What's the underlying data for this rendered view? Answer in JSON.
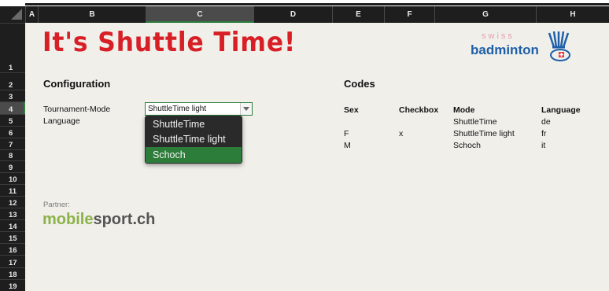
{
  "columns": [
    "A",
    "B",
    "C",
    "D",
    "E",
    "F",
    "G",
    "H"
  ],
  "selected_column": "C",
  "rows": [
    "1",
    "2",
    "3",
    "4",
    "5",
    "6",
    "7",
    "8",
    "9",
    "10",
    "11",
    "12",
    "13",
    "14",
    "15",
    "16",
    "17",
    "18",
    "19"
  ],
  "selected_row": "4",
  "title": "It's Shuttle Time!",
  "logo": {
    "top": "swiss",
    "main": "badminton"
  },
  "configuration": {
    "heading": "Configuration",
    "tournament_mode_label": "Tournament-Mode",
    "language_label": "Language",
    "dropdown": {
      "value": "ShuttleTime light",
      "options": [
        "ShuttleTime",
        "ShuttleTime light",
        "Schoch"
      ],
      "highlighted": "Schoch"
    }
  },
  "codes": {
    "heading": "Codes",
    "headers": [
      "Sex",
      "Checkbox",
      "Mode",
      "Language"
    ],
    "sex": [
      "F",
      "M"
    ],
    "checkbox": [
      "x"
    ],
    "mode": [
      "ShuttleTime",
      "ShuttleTime light",
      "Schoch"
    ],
    "language": [
      "de",
      "fr",
      "it"
    ]
  },
  "partner": {
    "label": "Partner:",
    "brand_part1": "mobile",
    "brand_part2": "sport.ch"
  },
  "colors": {
    "title": "#d81f26",
    "selection": "#2c7d3c",
    "brand_green": "#8cb34a"
  }
}
